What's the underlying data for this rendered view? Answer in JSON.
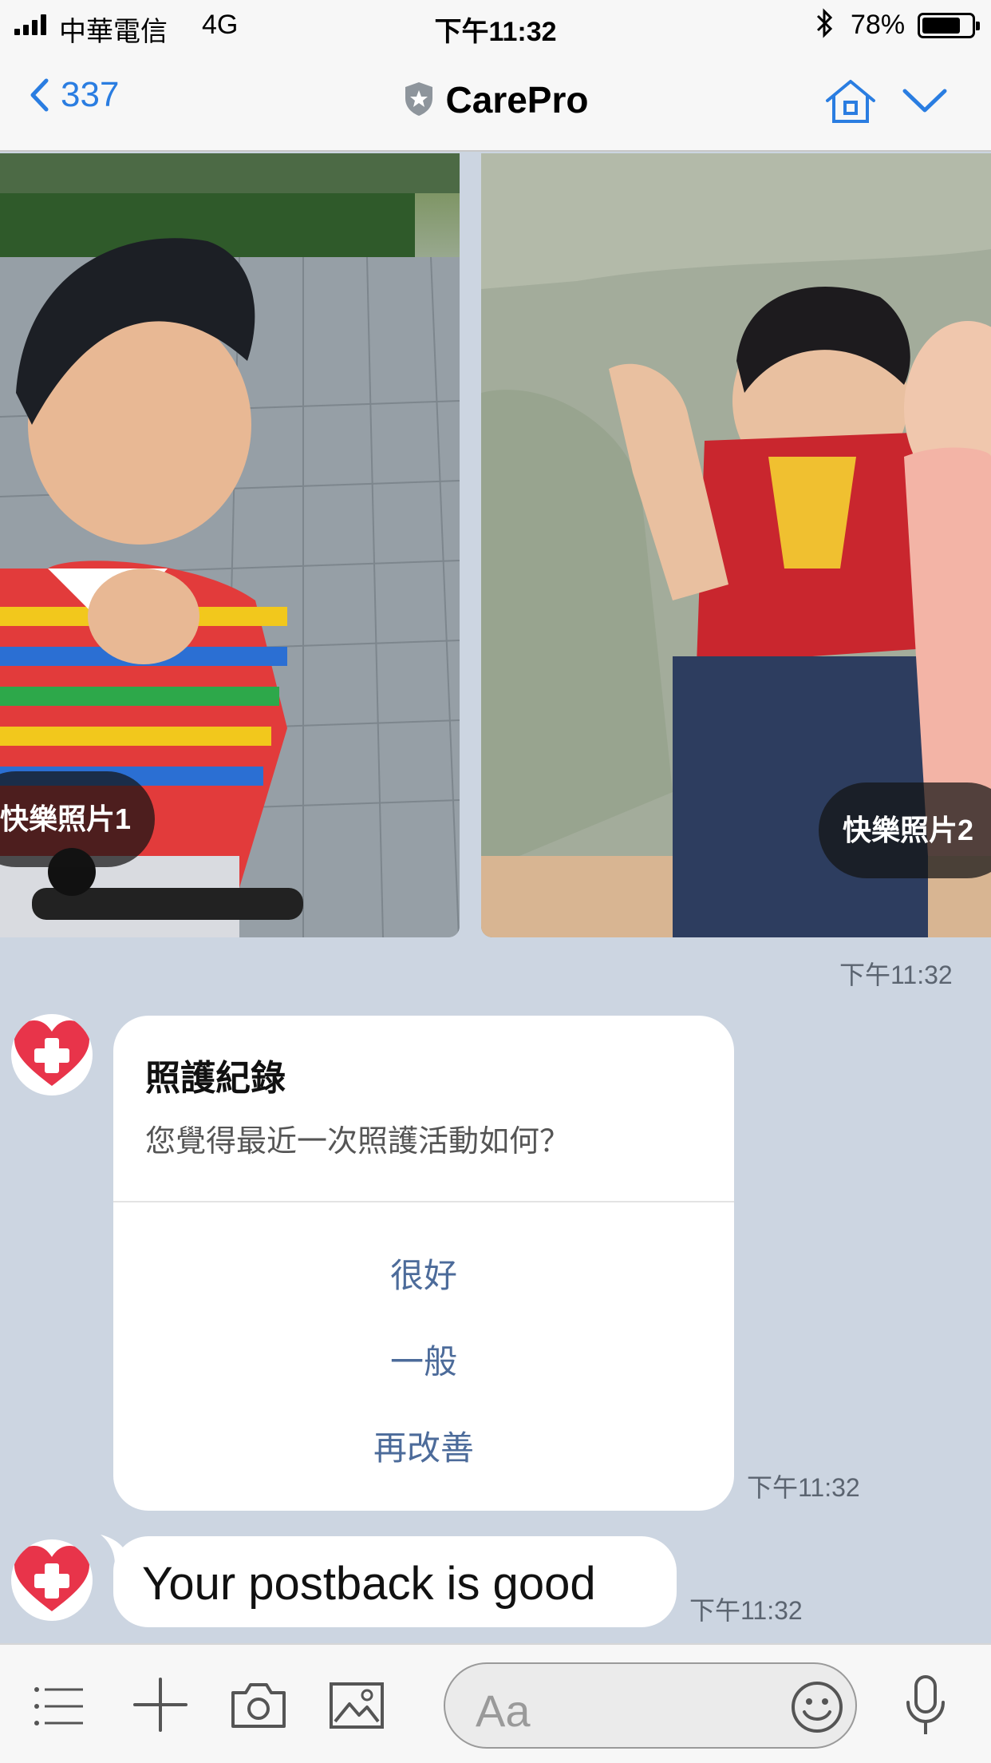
{
  "status_bar": {
    "carrier": "中華電信",
    "network": "4G",
    "time": "下午11:32",
    "bluetooth_icon": "bluetooth-icon",
    "battery_percent": "78%",
    "battery_level": 0.78
  },
  "nav": {
    "back_count": "337",
    "title": "CarePro",
    "icons": [
      "chevron-left-icon",
      "shield-icon",
      "home-icon",
      "chevron-down-icon"
    ]
  },
  "carousel": {
    "items": [
      {
        "label": "快樂照片1"
      },
      {
        "label": "快樂照片2"
      }
    ],
    "timestamp": "下午11:32"
  },
  "care_card": {
    "title": "照護紀錄",
    "text": "您覺得最近一次照護活動如何？",
    "actions": [
      "很好",
      "一般",
      "再改善"
    ],
    "timestamp": "下午11:32"
  },
  "reply": {
    "text": "Your postback is good",
    "timestamp": "下午11:32"
  },
  "input_bar": {
    "placeholder": "Aa",
    "icons": [
      "menu-icon",
      "plus-icon",
      "camera-icon",
      "image-icon",
      "emoji-icon",
      "microphone-icon"
    ]
  },
  "colors": {
    "chat_background": "#ccd5e1",
    "link_blue": "#2a7de1",
    "action_text": "#4c6b9a",
    "avatar_heart": "#e8344a"
  }
}
